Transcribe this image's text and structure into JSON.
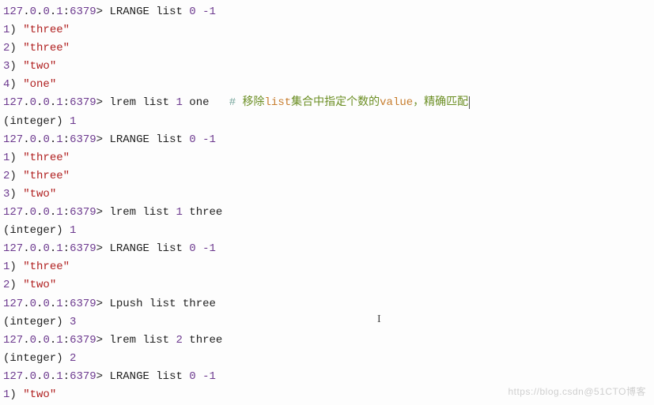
{
  "lines": [
    [
      {
        "cls": "purple",
        "t": "127"
      },
      {
        "cls": "black",
        "t": "."
      },
      {
        "cls": "purple",
        "t": "0"
      },
      {
        "cls": "black",
        "t": "."
      },
      {
        "cls": "purple",
        "t": "0"
      },
      {
        "cls": "black",
        "t": "."
      },
      {
        "cls": "purple",
        "t": "1"
      },
      {
        "cls": "black",
        "t": ":"
      },
      {
        "cls": "purple",
        "t": "6379"
      },
      {
        "cls": "black",
        "t": "> LRANGE list "
      },
      {
        "cls": "purple",
        "t": "0 -1"
      }
    ],
    [
      {
        "cls": "purple",
        "t": "1"
      },
      {
        "cls": "black",
        "t": ") "
      },
      {
        "cls": "red",
        "t": "\"three\""
      }
    ],
    [
      {
        "cls": "purple",
        "t": "2"
      },
      {
        "cls": "black",
        "t": ") "
      },
      {
        "cls": "red",
        "t": "\"three\""
      }
    ],
    [
      {
        "cls": "purple",
        "t": "3"
      },
      {
        "cls": "black",
        "t": ") "
      },
      {
        "cls": "red",
        "t": "\"two\""
      }
    ],
    [
      {
        "cls": "purple",
        "t": "4"
      },
      {
        "cls": "black",
        "t": ") "
      },
      {
        "cls": "red",
        "t": "\"one\""
      }
    ],
    [
      {
        "cls": "purple",
        "t": "127"
      },
      {
        "cls": "black",
        "t": "."
      },
      {
        "cls": "purple",
        "t": "0"
      },
      {
        "cls": "black",
        "t": "."
      },
      {
        "cls": "purple",
        "t": "0"
      },
      {
        "cls": "black",
        "t": "."
      },
      {
        "cls": "purple",
        "t": "1"
      },
      {
        "cls": "black",
        "t": ":"
      },
      {
        "cls": "purple",
        "t": "6379"
      },
      {
        "cls": "black",
        "t": "> lrem list "
      },
      {
        "cls": "purple",
        "t": "1"
      },
      {
        "cls": "black",
        "t": " one   "
      },
      {
        "cls": "teal",
        "t": "# "
      },
      {
        "cls": "green-comment",
        "t": "移除"
      },
      {
        "cls": "orange-comment",
        "t": "list"
      },
      {
        "cls": "green-comment",
        "t": "集合中指定个数的"
      },
      {
        "cls": "orange-comment",
        "t": "value"
      },
      {
        "cls": "green-comment",
        "t": "，精确匹配"
      }
    ],
    [
      {
        "cls": "black",
        "t": "(integer) "
      },
      {
        "cls": "purple",
        "t": "1"
      }
    ],
    [
      {
        "cls": "purple",
        "t": "127"
      },
      {
        "cls": "black",
        "t": "."
      },
      {
        "cls": "purple",
        "t": "0"
      },
      {
        "cls": "black",
        "t": "."
      },
      {
        "cls": "purple",
        "t": "0"
      },
      {
        "cls": "black",
        "t": "."
      },
      {
        "cls": "purple",
        "t": "1"
      },
      {
        "cls": "black",
        "t": ":"
      },
      {
        "cls": "purple",
        "t": "6379"
      },
      {
        "cls": "black",
        "t": "> LRANGE list "
      },
      {
        "cls": "purple",
        "t": "0 -1"
      }
    ],
    [
      {
        "cls": "purple",
        "t": "1"
      },
      {
        "cls": "black",
        "t": ") "
      },
      {
        "cls": "red",
        "t": "\"three\""
      }
    ],
    [
      {
        "cls": "purple",
        "t": "2"
      },
      {
        "cls": "black",
        "t": ") "
      },
      {
        "cls": "red",
        "t": "\"three\""
      }
    ],
    [
      {
        "cls": "purple",
        "t": "3"
      },
      {
        "cls": "black",
        "t": ") "
      },
      {
        "cls": "red",
        "t": "\"two\""
      }
    ],
    [
      {
        "cls": "purple",
        "t": "127"
      },
      {
        "cls": "black",
        "t": "."
      },
      {
        "cls": "purple",
        "t": "0"
      },
      {
        "cls": "black",
        "t": "."
      },
      {
        "cls": "purple",
        "t": "0"
      },
      {
        "cls": "black",
        "t": "."
      },
      {
        "cls": "purple",
        "t": "1"
      },
      {
        "cls": "black",
        "t": ":"
      },
      {
        "cls": "purple",
        "t": "6379"
      },
      {
        "cls": "black",
        "t": "> lrem list "
      },
      {
        "cls": "purple",
        "t": "1"
      },
      {
        "cls": "black",
        "t": " three"
      }
    ],
    [
      {
        "cls": "black",
        "t": "(integer) "
      },
      {
        "cls": "purple",
        "t": "1"
      }
    ],
    [
      {
        "cls": "purple",
        "t": "127"
      },
      {
        "cls": "black",
        "t": "."
      },
      {
        "cls": "purple",
        "t": "0"
      },
      {
        "cls": "black",
        "t": "."
      },
      {
        "cls": "purple",
        "t": "0"
      },
      {
        "cls": "black",
        "t": "."
      },
      {
        "cls": "purple",
        "t": "1"
      },
      {
        "cls": "black",
        "t": ":"
      },
      {
        "cls": "purple",
        "t": "6379"
      },
      {
        "cls": "black",
        "t": "> LRANGE list "
      },
      {
        "cls": "purple",
        "t": "0 -1"
      }
    ],
    [
      {
        "cls": "purple",
        "t": "1"
      },
      {
        "cls": "black",
        "t": ") "
      },
      {
        "cls": "red",
        "t": "\"three\""
      }
    ],
    [
      {
        "cls": "purple",
        "t": "2"
      },
      {
        "cls": "black",
        "t": ") "
      },
      {
        "cls": "red",
        "t": "\"two\""
      }
    ],
    [
      {
        "cls": "purple",
        "t": "127"
      },
      {
        "cls": "black",
        "t": "."
      },
      {
        "cls": "purple",
        "t": "0"
      },
      {
        "cls": "black",
        "t": "."
      },
      {
        "cls": "purple",
        "t": "0"
      },
      {
        "cls": "black",
        "t": "."
      },
      {
        "cls": "purple",
        "t": "1"
      },
      {
        "cls": "black",
        "t": ":"
      },
      {
        "cls": "purple",
        "t": "6379"
      },
      {
        "cls": "black",
        "t": "> Lpush list three"
      }
    ],
    [
      {
        "cls": "black",
        "t": "(integer) "
      },
      {
        "cls": "purple",
        "t": "3"
      }
    ],
    [
      {
        "cls": "purple",
        "t": "127"
      },
      {
        "cls": "black",
        "t": "."
      },
      {
        "cls": "purple",
        "t": "0"
      },
      {
        "cls": "black",
        "t": "."
      },
      {
        "cls": "purple",
        "t": "0"
      },
      {
        "cls": "black",
        "t": "."
      },
      {
        "cls": "purple",
        "t": "1"
      },
      {
        "cls": "black",
        "t": ":"
      },
      {
        "cls": "purple",
        "t": "6379"
      },
      {
        "cls": "black",
        "t": "> lrem list "
      },
      {
        "cls": "purple",
        "t": "2"
      },
      {
        "cls": "black",
        "t": " three"
      }
    ],
    [
      {
        "cls": "black",
        "t": "(integer) "
      },
      {
        "cls": "purple",
        "t": "2"
      }
    ],
    [
      {
        "cls": "purple",
        "t": "127"
      },
      {
        "cls": "black",
        "t": "."
      },
      {
        "cls": "purple",
        "t": "0"
      },
      {
        "cls": "black",
        "t": "."
      },
      {
        "cls": "purple",
        "t": "0"
      },
      {
        "cls": "black",
        "t": "."
      },
      {
        "cls": "purple",
        "t": "1"
      },
      {
        "cls": "black",
        "t": ":"
      },
      {
        "cls": "purple",
        "t": "6379"
      },
      {
        "cls": "black",
        "t": "> LRANGE list "
      },
      {
        "cls": "purple",
        "t": "0 -1"
      }
    ],
    [
      {
        "cls": "purple",
        "t": "1"
      },
      {
        "cls": "black",
        "t": ") "
      },
      {
        "cls": "red",
        "t": "\"two\""
      }
    ]
  ],
  "cursor_line_index": 5,
  "watermark": "https://blog.csdn@51CTO博客"
}
